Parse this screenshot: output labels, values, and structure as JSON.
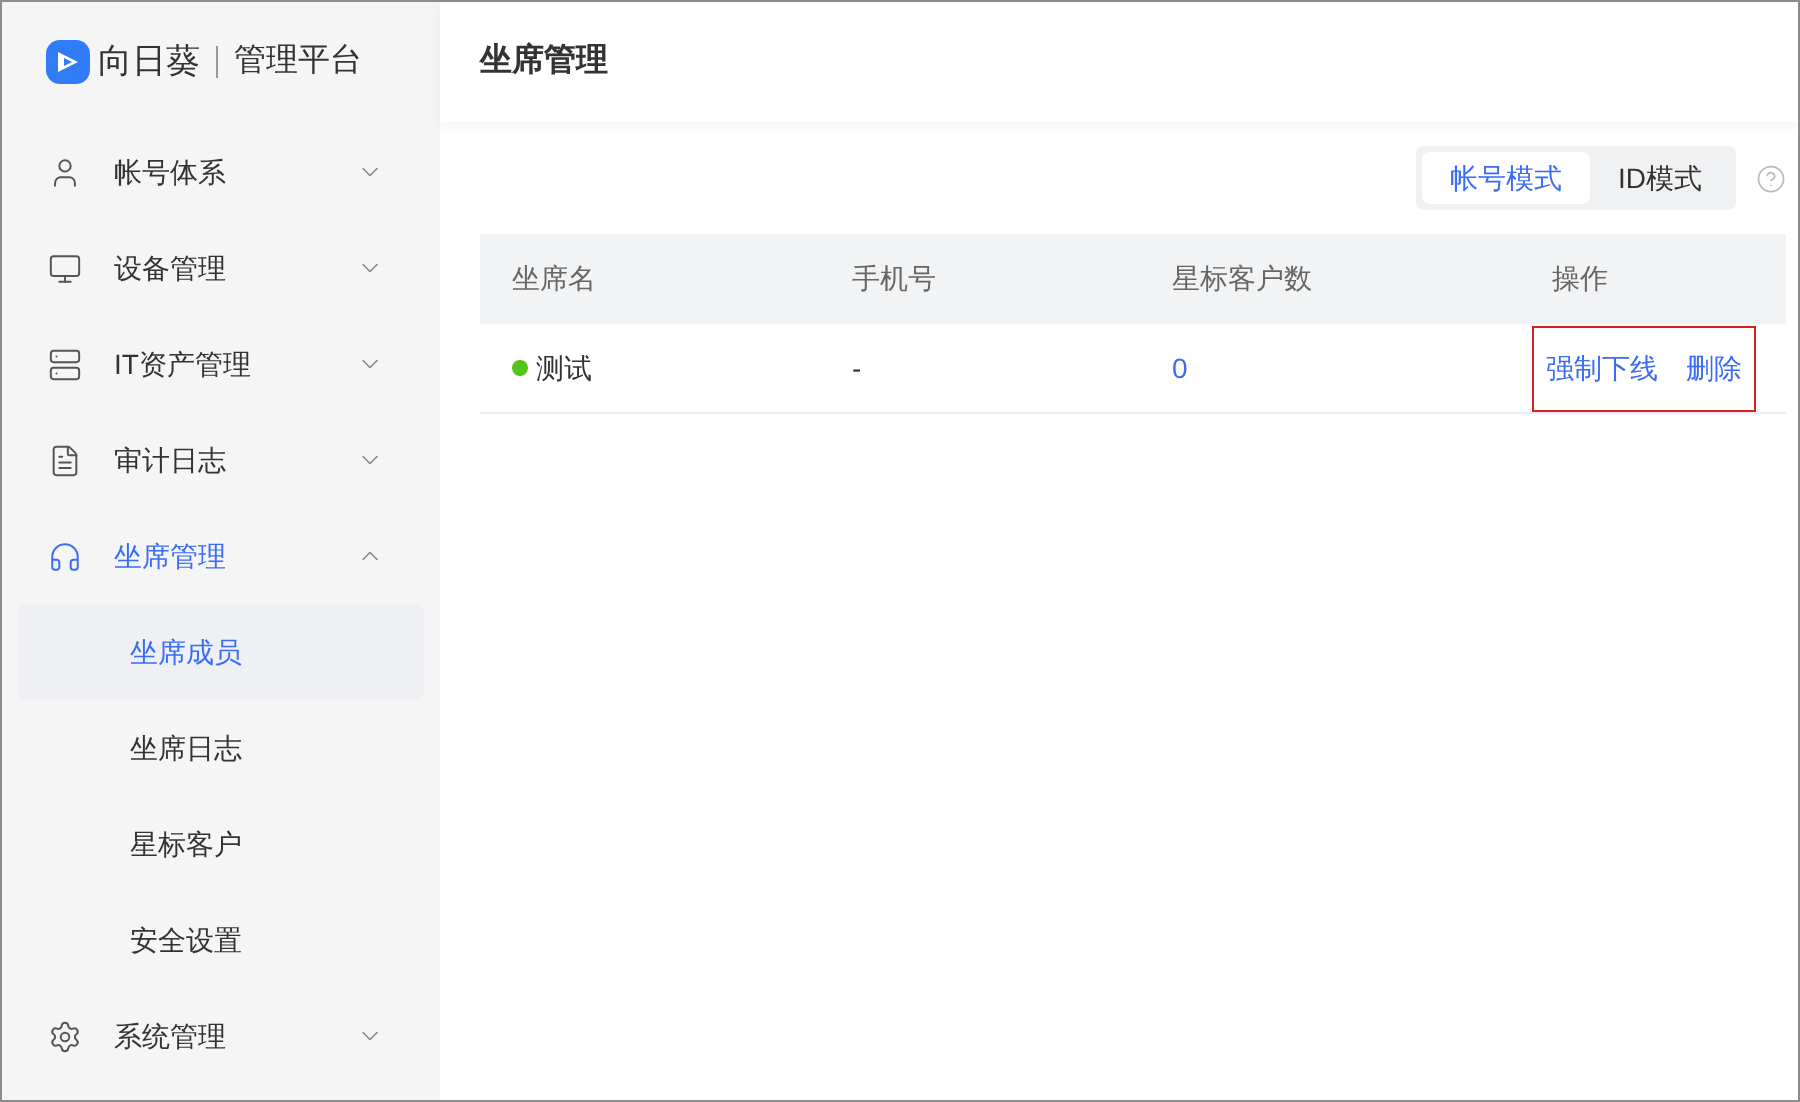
{
  "logo": {
    "brand": "向日葵",
    "product": "管理平台"
  },
  "sidebar": {
    "items": [
      {
        "label": "帐号体系",
        "expanded": false
      },
      {
        "label": "设备管理",
        "expanded": false
      },
      {
        "label": "IT资产管理",
        "expanded": false
      },
      {
        "label": "审计日志",
        "expanded": false
      },
      {
        "label": "坐席管理",
        "expanded": true,
        "children": [
          {
            "label": "坐席成员",
            "selected": true
          },
          {
            "label": "坐席日志",
            "selected": false
          },
          {
            "label": "星标客户",
            "selected": false
          },
          {
            "label": "安全设置",
            "selected": false
          }
        ]
      },
      {
        "label": "系统管理",
        "expanded": false
      }
    ]
  },
  "page_title": "坐席管理",
  "mode_tabs": [
    {
      "label": "帐号模式",
      "selected": true
    },
    {
      "label": "ID模式",
      "selected": false
    }
  ],
  "table": {
    "columns": [
      "坐席名",
      "手机号",
      "星标客户数",
      "操作"
    ],
    "rows": [
      {
        "name": "测试",
        "color": "#52c41a",
        "phone": "-",
        "star_customers": "0",
        "actions": [
          "强制下线",
          "删除"
        ],
        "actions_highlighted": true
      }
    ]
  }
}
